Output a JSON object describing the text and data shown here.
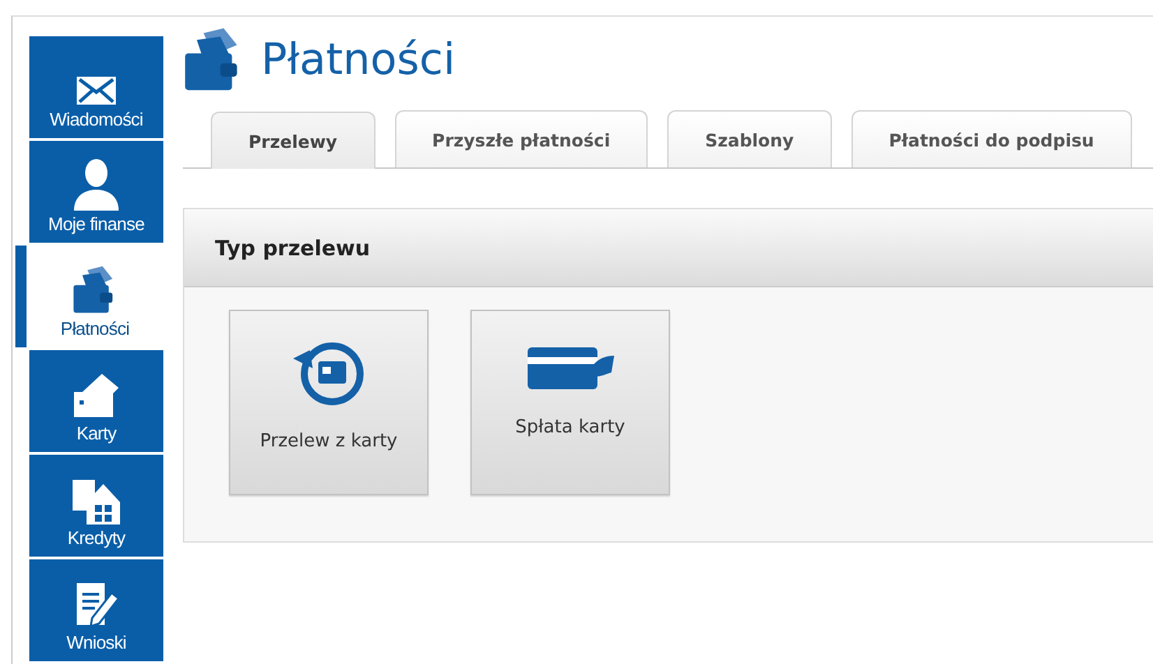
{
  "sidebar": {
    "items": [
      {
        "kind": "messages",
        "label": "Wiadomości",
        "selected": false
      },
      {
        "kind": "finance",
        "label": "Moje finanse",
        "selected": false
      },
      {
        "kind": "payments",
        "label": "Płatności",
        "selected": true
      },
      {
        "kind": "cards",
        "label": "Karty",
        "selected": false
      },
      {
        "kind": "loans",
        "label": "Kredyty",
        "selected": false
      },
      {
        "kind": "applications",
        "label": "Wnioski",
        "selected": false
      }
    ]
  },
  "page": {
    "title": "Płatności"
  },
  "tabs": [
    {
      "label": "Przelewy",
      "selected": true
    },
    {
      "label": "Przyszłe płatności",
      "selected": false
    },
    {
      "label": "Szablony",
      "selected": false
    },
    {
      "label": "Płatności do podpisu",
      "selected": false
    }
  ],
  "panel": {
    "title": "Typ przelewu",
    "tiles": [
      {
        "kind": "card-transfer",
        "label": "Przelew z karty"
      },
      {
        "kind": "card-repayment",
        "label": "Spłata karty"
      }
    ]
  }
}
